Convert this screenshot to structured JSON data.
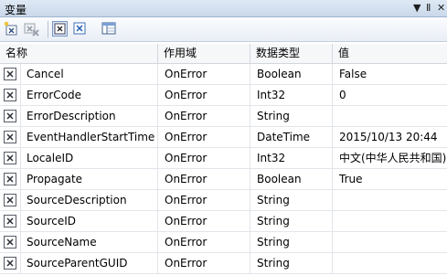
{
  "window": {
    "title": "变量",
    "dropdown_glyph": "▼",
    "pin_glyph": "Ⅱ",
    "close_glyph": "✕"
  },
  "toolbar": {
    "buttons": [
      {
        "name": "add-variable-button",
        "icon": "add-variable-icon"
      },
      {
        "name": "delete-variable-button",
        "icon": "delete-variable-icon"
      },
      {
        "name": "show-system-variables-button",
        "icon": "system-variable-icon",
        "pressed": true
      },
      {
        "name": "show-all-variables-button",
        "icon": "user-variable-icon"
      },
      {
        "name": "choose-columns-button",
        "icon": "columns-icon"
      }
    ]
  },
  "grid": {
    "columns": [
      "名称",
      "作用域",
      "数据类型",
      "值"
    ],
    "rows": [
      {
        "name": "Cancel",
        "scope": "OnError",
        "type": "Boolean",
        "value": "False"
      },
      {
        "name": "ErrorCode",
        "scope": "OnError",
        "type": "Int32",
        "value": "0"
      },
      {
        "name": "ErrorDescription",
        "scope": "OnError",
        "type": "String",
        "value": ""
      },
      {
        "name": "EventHandlerStartTime",
        "scope": "OnError",
        "type": "DateTime",
        "value": "2015/10/13 20:44"
      },
      {
        "name": "LocaleID",
        "scope": "OnError",
        "type": "Int32",
        "value": "中文(中华人民共和国)"
      },
      {
        "name": "Propagate",
        "scope": "OnError",
        "type": "Boolean",
        "value": "True"
      },
      {
        "name": "SourceDescription",
        "scope": "OnError",
        "type": "String",
        "value": ""
      },
      {
        "name": "SourceID",
        "scope": "OnError",
        "type": "String",
        "value": ""
      },
      {
        "name": "SourceName",
        "scope": "OnError",
        "type": "String",
        "value": ""
      },
      {
        "name": "SourceParentGUID",
        "scope": "OnError",
        "type": "String",
        "value": ""
      }
    ]
  },
  "colors": {
    "accent": "#7a96c4",
    "header_bg": "#f6f7f9",
    "grid_line": "#e2e5ea"
  }
}
